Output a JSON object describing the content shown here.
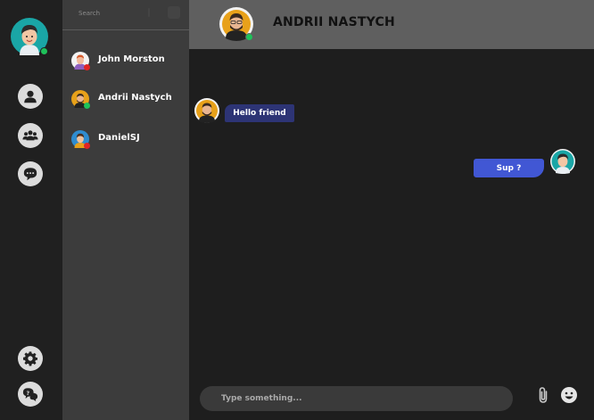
{
  "current_user": {
    "status": "online"
  },
  "rail": {
    "items": [
      {
        "icon": "person-icon"
      },
      {
        "icon": "group-icon"
      },
      {
        "icon": "chat-bubble-icon"
      },
      {
        "icon": "gear-icon"
      },
      {
        "icon": "help-chat-icon"
      }
    ]
  },
  "contacts": {
    "search_placeholder": "Search",
    "items": [
      {
        "name": "John Morston",
        "status": "offline"
      },
      {
        "name": "Andrii Nastych",
        "status": "online"
      },
      {
        "name": "DanielSJ",
        "status": "offline"
      }
    ]
  },
  "chat": {
    "title": "ANDRII NASTYCH",
    "messages": [
      {
        "direction": "incoming",
        "text": "Hello friend"
      },
      {
        "direction": "outgoing",
        "text": "Sup ?"
      }
    ]
  },
  "composer": {
    "placeholder": "Type something...",
    "value": ""
  },
  "colors": {
    "online": "#1fc15a",
    "offline": "#e02424",
    "incoming_bubble": "#2d3475",
    "outgoing_bubble": "#4157d4",
    "header": "#5f5f5f",
    "sidebar": "#3c3c3c",
    "rail": "#202020",
    "chat_bg": "#1e1e1e"
  }
}
